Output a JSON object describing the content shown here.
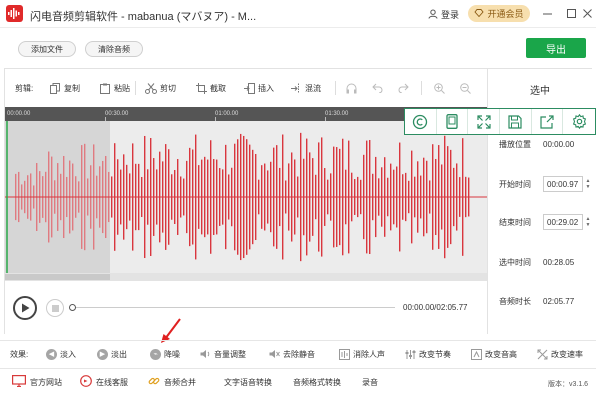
{
  "titlebar": {
    "title": "闪电音频剪辑软件 - mabanua (マバヌア) - M...",
    "login_label": "登录",
    "vip_label": "开通会员"
  },
  "topbar": {
    "add_file_label": "添加文件",
    "clear_audio_label": "清除音频",
    "export_label": "导出"
  },
  "toolbar": {
    "section_label": "剪辑:",
    "items": [
      {
        "label": "复制",
        "icon": "copy-icon"
      },
      {
        "label": "粘贴",
        "icon": "paste-icon"
      },
      {
        "label": "剪切",
        "icon": "scissors-icon"
      },
      {
        "label": "截取",
        "icon": "crop-icon"
      },
      {
        "label": "插入",
        "icon": "insert-icon"
      },
      {
        "label": "混流",
        "icon": "mix-icon"
      }
    ]
  },
  "ruler": {
    "ticks": [
      "00:00.00",
      "00:30.00",
      "01:00.00",
      "01:30.00"
    ]
  },
  "playback": {
    "time_readout": "00:00.00/02:05.77"
  },
  "side_panel": {
    "title": "选中",
    "rows": [
      {
        "label": "播放位置",
        "value": "00:00.00",
        "editable": false
      },
      {
        "label": "开始时间",
        "value": "00:00.97",
        "editable": true
      },
      {
        "label": "结束时间",
        "value": "00:29.02",
        "editable": true
      },
      {
        "label": "选中时间",
        "value": "00:28.05",
        "editable": false
      },
      {
        "label": "音频时长",
        "value": "02:05.77",
        "editable": false
      }
    ]
  },
  "quick_tools": [
    "copyright-icon",
    "phone-icon",
    "expand-icon",
    "save-icon",
    "share-icon",
    "settings-icon"
  ],
  "effects": {
    "section_label": "效果:",
    "items": [
      {
        "label": "淡入",
        "icon": "fade-in-icon"
      },
      {
        "label": "淡出",
        "icon": "fade-out-icon"
      },
      {
        "label": "降噪",
        "icon": "denoise-icon"
      },
      {
        "label": "音量调整",
        "icon": "volume-icon"
      },
      {
        "label": "去除静音",
        "icon": "mute-remove-icon"
      },
      {
        "label": "消除人声",
        "icon": "vocal-remove-icon"
      },
      {
        "label": "改变节奏",
        "icon": "tempo-icon"
      },
      {
        "label": "改变音高",
        "icon": "pitch-icon"
      },
      {
        "label": "改变速率",
        "icon": "speed-icon"
      }
    ]
  },
  "footer": {
    "items": [
      {
        "label": "官方网站",
        "icon": "monitor-icon"
      },
      {
        "label": "在线客服",
        "icon": "service-icon"
      },
      {
        "label": "音频合并",
        "icon": "link-icon"
      },
      {
        "label": "文字语音转换",
        "icon": ""
      },
      {
        "label": "音频格式转换",
        "icon": ""
      },
      {
        "label": "录音",
        "icon": ""
      }
    ],
    "version": "版本：v3.1.6"
  },
  "colors": {
    "waveform": "#d9363e",
    "export_button": "#1aa64a",
    "accent_border": "#2c8c61",
    "vip_bg": "#f7dfae",
    "annotation_arrow": "#e02020"
  }
}
